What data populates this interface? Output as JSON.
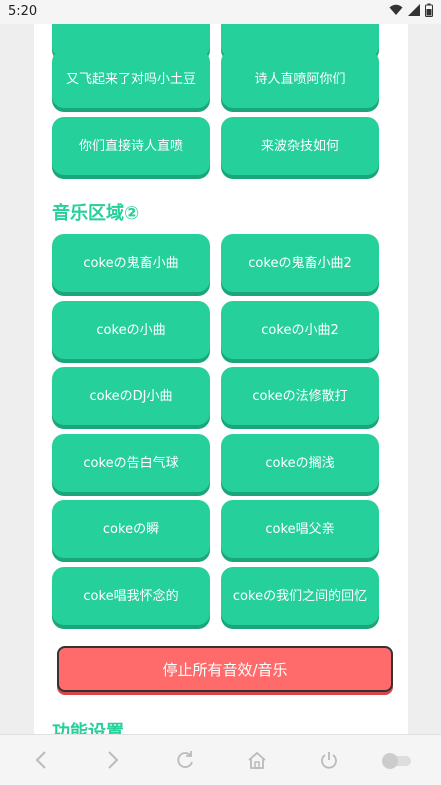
{
  "status": {
    "time": "5:20"
  },
  "top_buttons": [
    {
      "label": ""
    },
    {
      "label": ""
    },
    {
      "label": "又飞起来了对吗小土豆"
    },
    {
      "label": "诗人直喷阿你们"
    },
    {
      "label": "你们直接诗人直喷"
    },
    {
      "label": "来波杂技如何"
    }
  ],
  "music_section": {
    "title": "音乐区域②",
    "buttons": [
      {
        "label": "cokeの鬼畜小曲"
      },
      {
        "label": "cokeの鬼畜小曲2"
      },
      {
        "label": "cokeの小曲"
      },
      {
        "label": "cokeの小曲2"
      },
      {
        "label": "cokeのDJ小曲"
      },
      {
        "label": "cokeの法修散打"
      },
      {
        "label": "cokeの告白气球"
      },
      {
        "label": "cokeの搁浅"
      },
      {
        "label": "cokeの瞬"
      },
      {
        "label": "coke唱父亲"
      },
      {
        "label": "coke唱我怀念的"
      },
      {
        "label": "cokeの我们之间的回忆"
      }
    ]
  },
  "stop_button": {
    "label": "停止所有音效/音乐"
  },
  "settings_section": {
    "title": "功能设置"
  },
  "colors": {
    "accent": "#26d09a",
    "stop": "#ff6b6b"
  }
}
